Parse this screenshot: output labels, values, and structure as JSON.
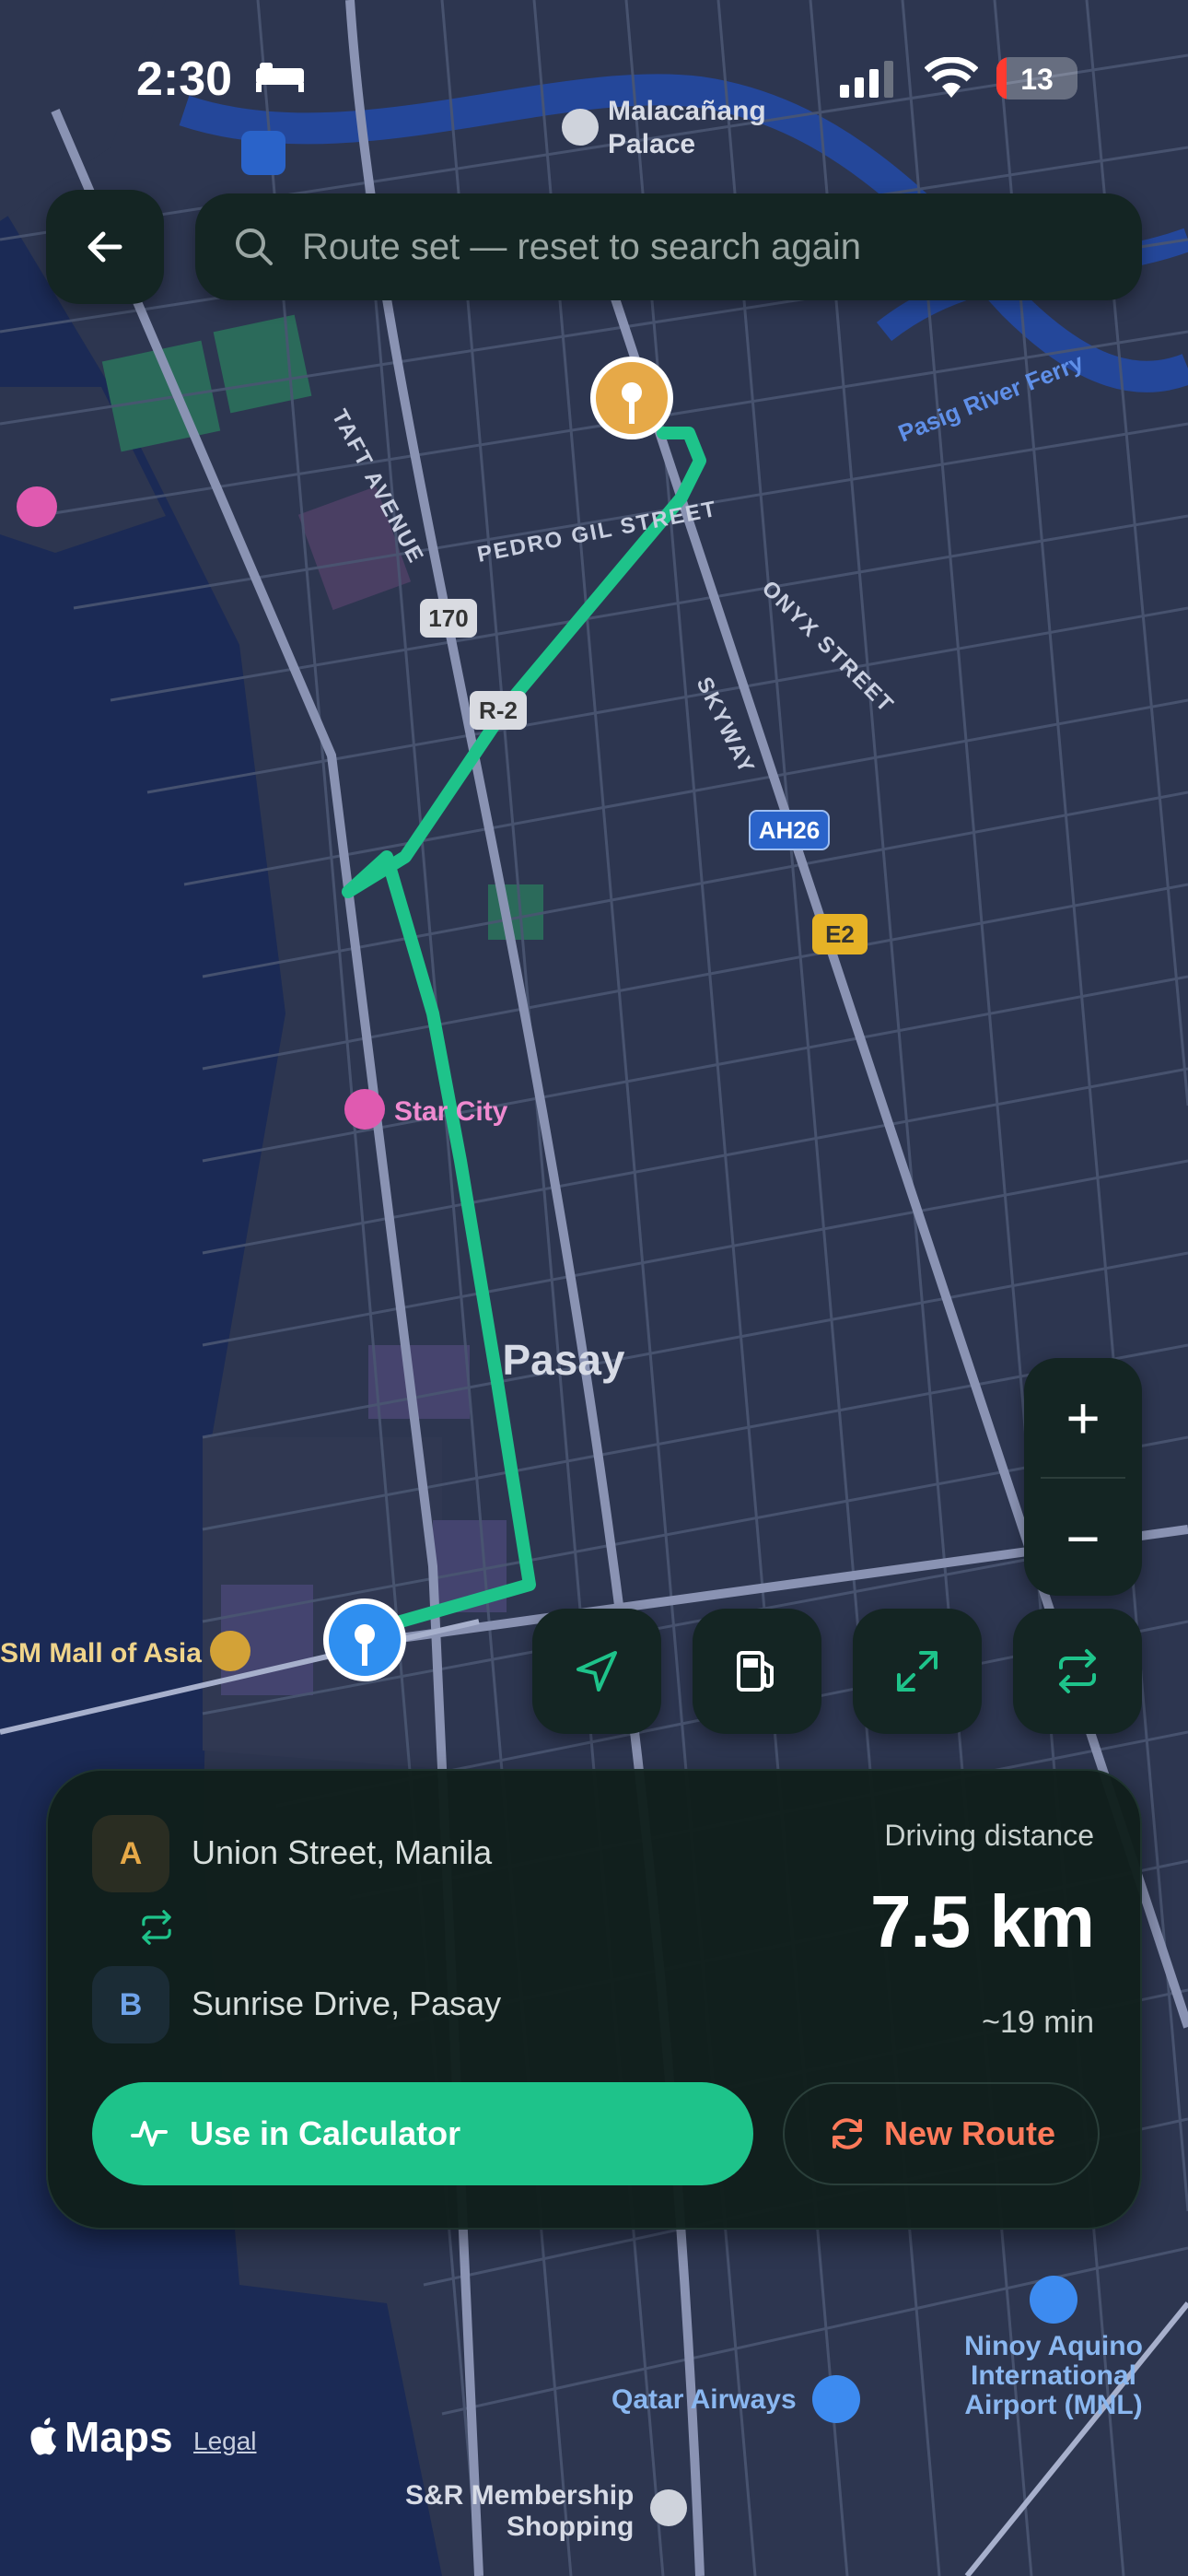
{
  "status_bar": {
    "time": "2:30",
    "battery": "13",
    "battery_level": 0.13
  },
  "search": {
    "text": "Route set — reset to search again"
  },
  "map": {
    "district_label": "Pasay",
    "streets": [
      "PEDRO GIL STREET",
      "TAFT AVENUE",
      "ONYX STREET",
      "SKYWAY"
    ],
    "shields": [
      "170",
      "R-2",
      "AH26",
      "E2"
    ],
    "pois": [
      "Malacañang Palace",
      "Star City",
      "SM Mall of Asia",
      "Qatar Airways",
      "Ninoy Aquino International Airport (MNL)",
      "S&R Membership Shopping",
      "Pasig River Ferry"
    ],
    "route_color": "#1ec38a",
    "water_color": "#1b2a55"
  },
  "zoom": {
    "in": "+",
    "out": "−"
  },
  "tools": [
    "locate-icon",
    "fuel-icon",
    "expand-icon",
    "swap-icon"
  ],
  "route_card": {
    "origin_badge": "A",
    "origin": "Union Street, Manila",
    "destination_badge": "B",
    "destination": "Sunrise Drive, Pasay",
    "distance_label": "Driving distance",
    "distance": "7.5 km",
    "duration": "~19 min",
    "use_button": "Use in Calculator",
    "new_button": "New Route"
  },
  "footer": {
    "brand": "Maps",
    "legal": "Legal"
  },
  "colors": {
    "accent": "#1ec38a",
    "danger": "#ff7a5a",
    "panel": "#142523"
  }
}
